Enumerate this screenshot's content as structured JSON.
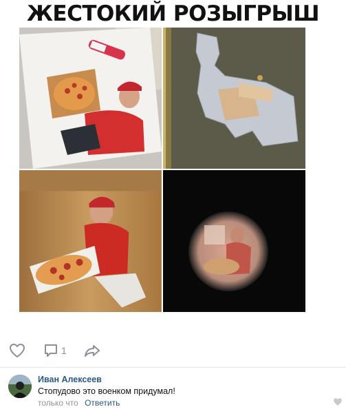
{
  "post": {
    "title": "ЖЕСТОКИЙ РОЗЫГРЫШ",
    "photos": [
      {
        "name": "photo-pizza-guy-printout",
        "accent": "#d33a2c"
      },
      {
        "name": "photo-cutout-on-door",
        "accent": "#c8cdd6"
      },
      {
        "name": "photo-cutout-standing",
        "accent": "#c62b22"
      },
      {
        "name": "photo-peephole-view",
        "accent": "#e2b8a8"
      }
    ]
  },
  "actions": {
    "like_icon": "heart-icon",
    "comment_icon": "comment-icon",
    "comment_count": "1",
    "share_icon": "share-icon"
  },
  "comment": {
    "author": "Иван Алексеев",
    "text": "Стопудово это военком придумал!",
    "time": "только что",
    "reply_label": "Ответить"
  },
  "colors": {
    "link": "#2a5885",
    "muted": "#939393",
    "icon": "#8a8f98"
  }
}
